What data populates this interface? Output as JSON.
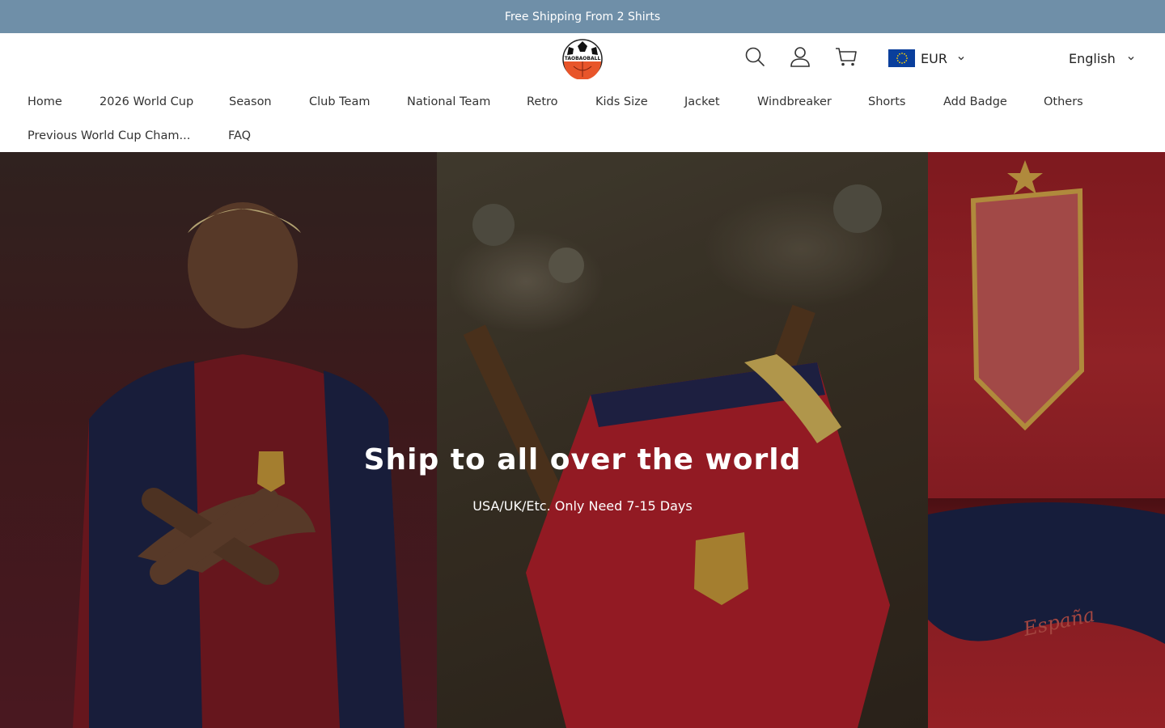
{
  "announcement": {
    "text": "Free Shipping From 2 Shirts"
  },
  "header": {
    "logo_text": "TAOBAOBALL",
    "icons": [
      "search-icon",
      "account-icon",
      "cart-icon"
    ],
    "currency": {
      "code": "EUR",
      "flag": "eu-flag"
    },
    "language": {
      "label": "English"
    }
  },
  "nav": {
    "row1": [
      "Home",
      "2026 World Cup",
      "Season",
      "Club Team",
      "National Team",
      "Retro",
      "Kids Size",
      "Jacket",
      "Windbreaker",
      "Shorts",
      "Add Badge",
      "Others"
    ],
    "row2": [
      "Previous World Cup Cham...",
      "FAQ"
    ]
  },
  "hero": {
    "title": "Ship to all over the world",
    "subtitle": "USA/UK/Etc. Only Need 7-15 Days"
  },
  "colors": {
    "announcement_bg": "#6f8fa8",
    "text_dark": "#222222",
    "hero_text": "#ffffff"
  }
}
